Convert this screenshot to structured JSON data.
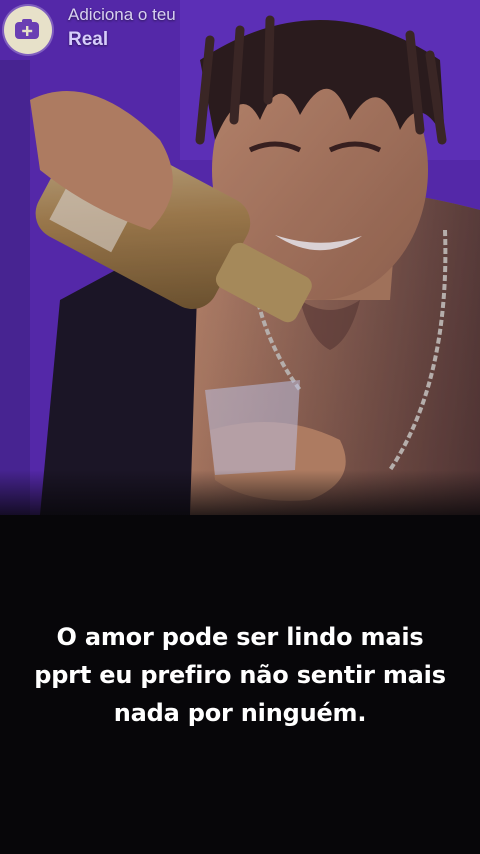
{
  "promo": {
    "line1": "Adiciona o teu",
    "line2": "Real",
    "icon": "camera-plus-icon"
  },
  "caption": {
    "text": "O amor pode ser lindo mais pprt eu prefiro não sentir mais nada por ninguém."
  },
  "colors": {
    "background": "#070609",
    "photo_backdrop": "#5a2bb0",
    "badge": "#e7e1c9",
    "badge_icon": "#6a3fb3",
    "caption_text": "#ffffff"
  }
}
